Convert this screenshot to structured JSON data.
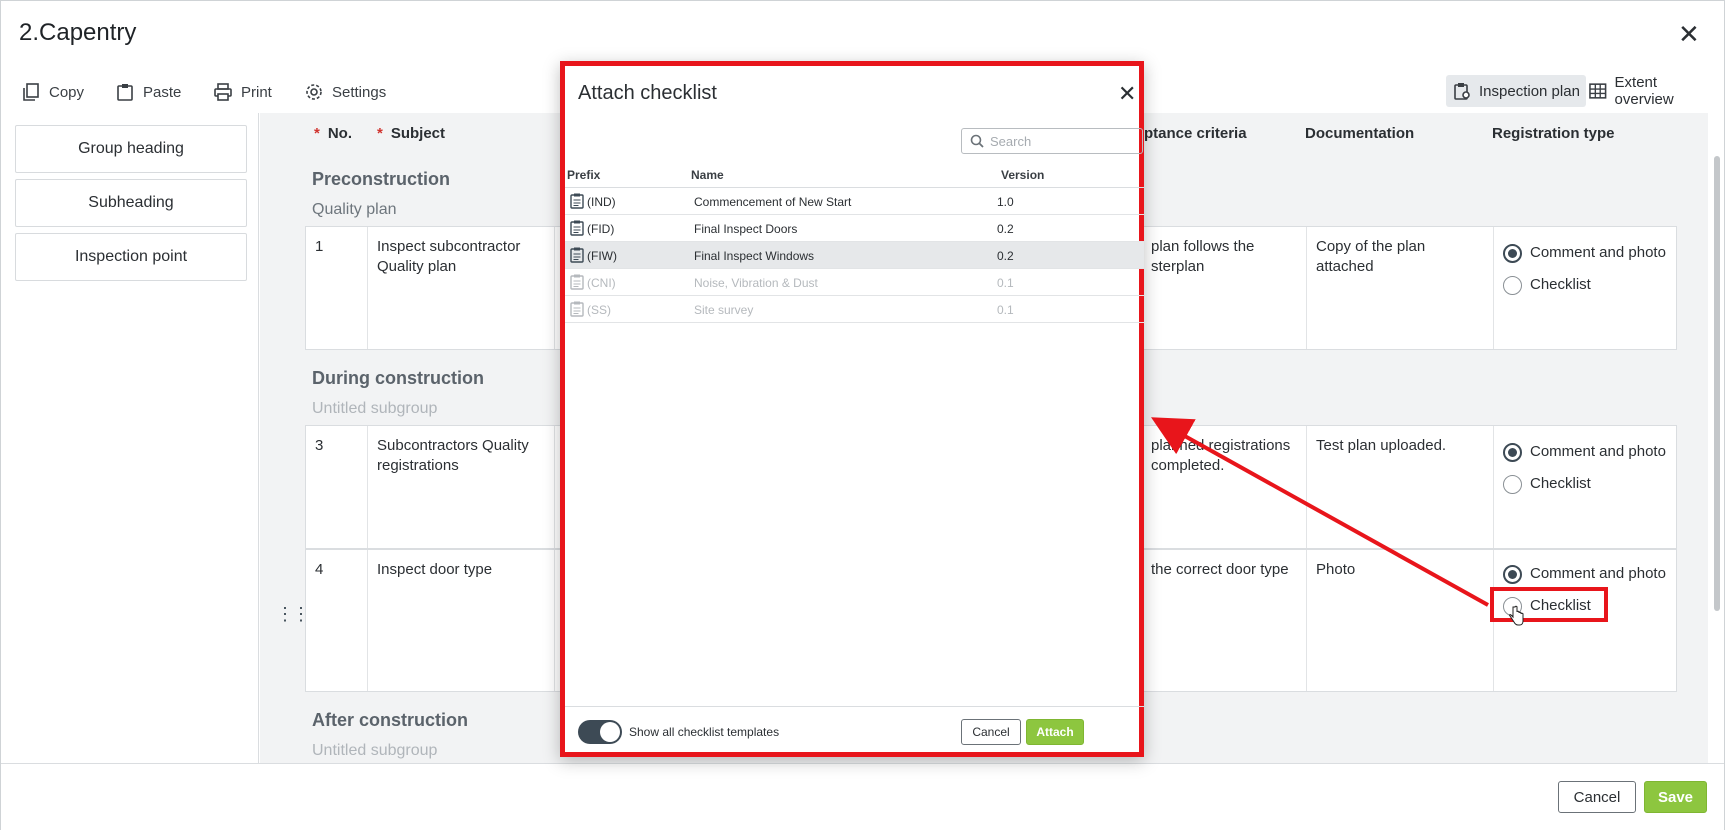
{
  "window": {
    "title": "2.Capentry"
  },
  "toolbar": {
    "copy": "Copy",
    "paste": "Paste",
    "print": "Print",
    "settings": "Settings",
    "inspection_plan": "Inspection plan",
    "extent_overview": "Extent overview"
  },
  "palette": {
    "items": [
      "Group heading",
      "Subheading",
      "Inspection point"
    ]
  },
  "table": {
    "headers": {
      "no": "No.",
      "subject": "Subject",
      "acceptance_criteria": "ptance criteria",
      "documentation": "Documentation",
      "registration_type": "Registration type"
    },
    "groups": [
      {
        "heading": "Preconstruction",
        "subgroup": "Quality plan"
      },
      {
        "heading": "During construction",
        "subgroup": "Untitled subgroup"
      },
      {
        "heading": "After construction",
        "subgroup": "Untitled subgroup"
      }
    ],
    "rows": [
      {
        "no": "1",
        "subject": "Inspect subcontractor Quality plan",
        "criteria": "plan follows the sterplan",
        "documentation": "Copy of the plan attached",
        "options": [
          "Comment and photo",
          "Checklist"
        ],
        "selected": "Comment and photo"
      },
      {
        "no": "3",
        "subject": "Subcontractors Quality registrations",
        "criteria": "planned registrations completed.",
        "documentation": "Test plan uploaded.",
        "options": [
          "Comment and photo",
          "Checklist"
        ],
        "selected": "Comment and photo"
      },
      {
        "no": "4",
        "subject": "Inspect door type",
        "criteria": "the correct door type",
        "documentation": "Photo",
        "options": [
          "Comment and photo",
          "Checklist"
        ],
        "selected": "Comment and photo"
      }
    ]
  },
  "footer": {
    "cancel": "Cancel",
    "save": "Save"
  },
  "modal": {
    "title": "Attach checklist",
    "search_placeholder": "Search",
    "columns": {
      "prefix": "Prefix",
      "name": "Name",
      "version": "Version"
    },
    "rows": [
      {
        "prefix": "(IND)",
        "name": "Commencement of New Start",
        "version": "1.0",
        "state": "normal"
      },
      {
        "prefix": "(FID)",
        "name": "Final Inspect Doors",
        "version": "0.2",
        "state": "normal"
      },
      {
        "prefix": "(FIW)",
        "name": "Final Inspect Windows",
        "version": "0.2",
        "state": "selected"
      },
      {
        "prefix": "(CNI)",
        "name": "Noise, Vibration & Dust",
        "version": "0.1",
        "state": "disabled"
      },
      {
        "prefix": "(SS)",
        "name": "Site survey",
        "version": "0.1",
        "state": "disabled"
      }
    ],
    "toggle_label": "Show all checklist templates",
    "toggle_on": true,
    "cancel": "Cancel",
    "attach": "Attach"
  },
  "colors": {
    "accent_green": "#8dc63f",
    "annotation_red": "#e8151b",
    "dark": "#3d4a55"
  }
}
